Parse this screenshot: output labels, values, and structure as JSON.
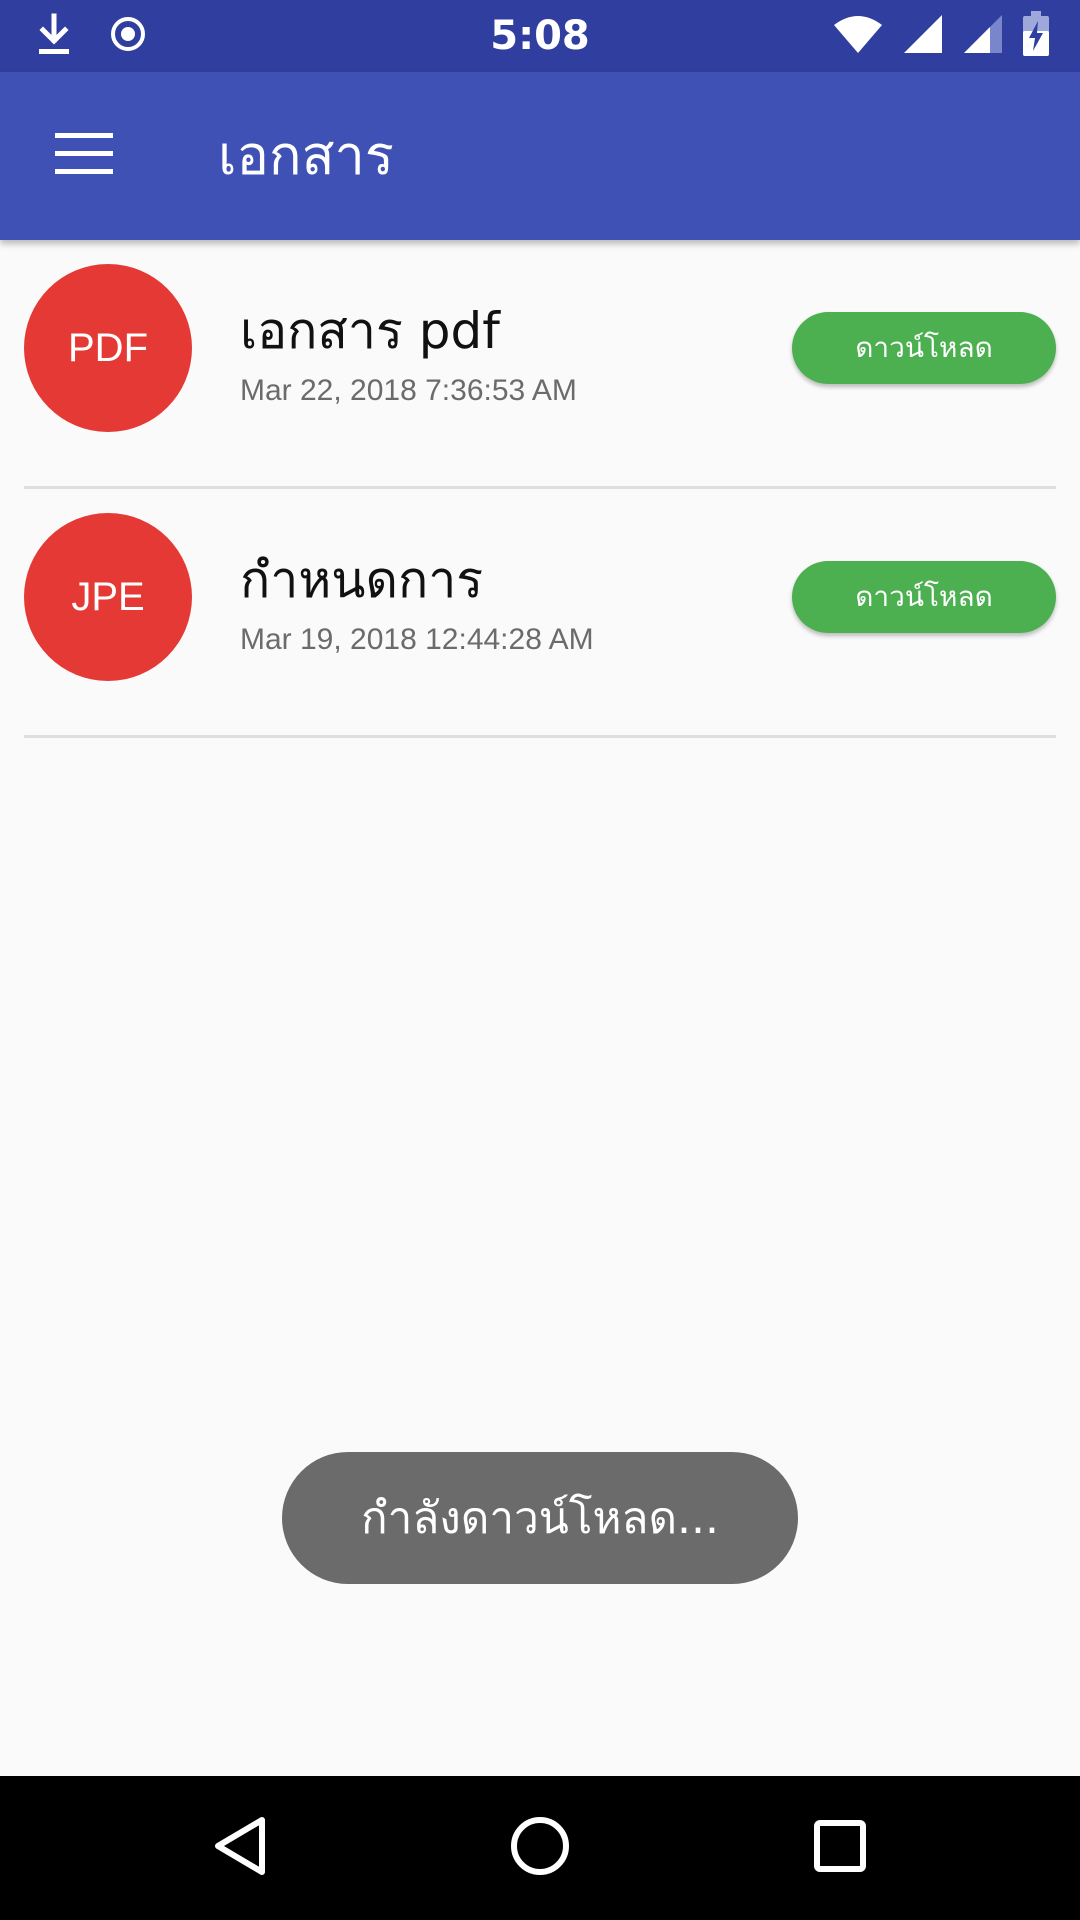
{
  "status_bar": {
    "time": "5:08",
    "left_icons": [
      "download-icon",
      "sync-icon"
    ],
    "right_icons": [
      "wifi-icon",
      "signal-icon",
      "signal-icon",
      "battery-charging-icon"
    ]
  },
  "app_bar": {
    "title": "เอกสาร",
    "menu_icon": "hamburger-menu-icon",
    "color": "#3f51b5"
  },
  "documents": [
    {
      "type_label": "PDF",
      "title": "เอกสาร pdf",
      "date": "Mar 22, 2018 7:36:53 AM",
      "button_label": "ดาวน์โหลด"
    },
    {
      "type_label": "JPE",
      "title": "กำหนดการ",
      "date": "Mar 19, 2018 12:44:28 AM",
      "button_label": "ดาวน์โหลด"
    }
  ],
  "toast": {
    "text": "กำลังดาวน์โหลด..."
  },
  "nav_bar": {
    "icons": [
      "back-icon",
      "home-icon",
      "recent-apps-icon"
    ]
  },
  "colors": {
    "status_bar": "#303f9f",
    "avatar": "#e53935",
    "download_button": "#4caf50",
    "toast": "#6b6b6b"
  }
}
